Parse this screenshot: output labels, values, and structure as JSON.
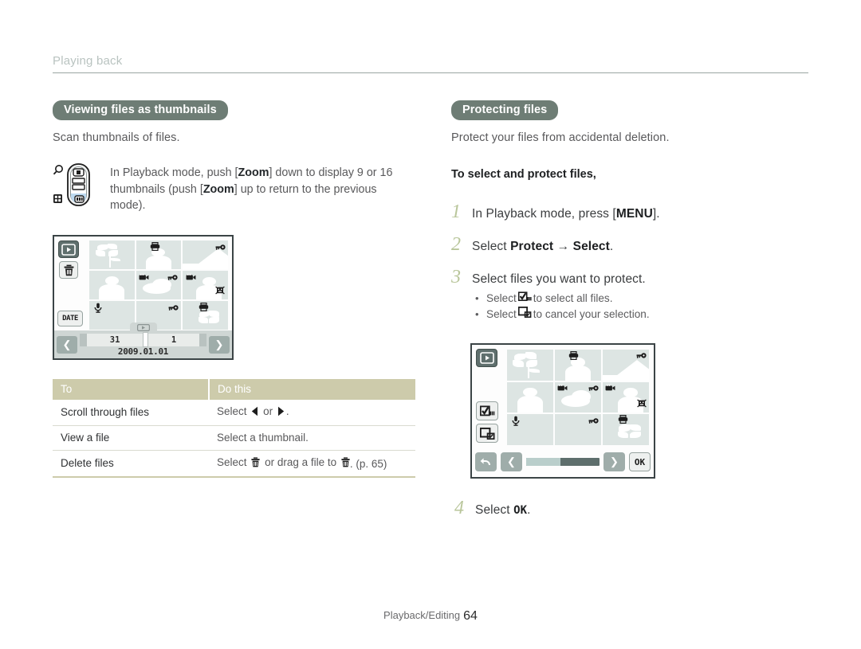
{
  "running_header": "Playing back",
  "left": {
    "section_title": "Viewing files as thumbnails",
    "lead": "Scan thumbnails of files.",
    "note": {
      "text_before_1": "In Playback mode, push [",
      "zoom_1": "Zoom",
      "text_mid_1": "] down to display 9 or 16",
      "text_before_2": "thumbnails (push [",
      "zoom_2": "Zoom",
      "text_mid_2": "] up to return to the previous mode)."
    },
    "lcd": {
      "date_left": "31",
      "date_right": "1",
      "date_label": "2009.01.01",
      "date_button": "DATE"
    },
    "table": {
      "headers": [
        "To",
        "Do this"
      ],
      "rows": [
        {
          "to": "Scroll through files",
          "do_pre": "Select",
          "do_mid": "or",
          "do_post": "."
        },
        {
          "to": "View a file",
          "do_pre": "Select a thumbnail.",
          "do_mid": "",
          "do_post": ""
        },
        {
          "to": "Delete files",
          "do_pre": "Select",
          "do_mid": "or drag a file to",
          "do_post": ". (p. 65)"
        }
      ]
    }
  },
  "right": {
    "section_title": "Protecting files",
    "lead": "Protect your files from accidental deletion.",
    "sub_head": "To select and protect files,",
    "steps": [
      {
        "num": "1",
        "pre": "In Playback mode, press [",
        "bold": "MENU",
        "post": "]."
      },
      {
        "num": "2",
        "pre": "Select ",
        "bold": "Protect",
        "arrow": " → ",
        "bold2": "Select",
        "post": "."
      },
      {
        "num": "3",
        "pre": "Select files you want to protect.",
        "bold": "",
        "post": ""
      },
      {
        "num": "4",
        "pre": "Select ",
        "bold": "OK",
        "post": "."
      }
    ],
    "bullets": [
      {
        "pre": "Select",
        "post": "to select all files."
      },
      {
        "pre": "Select",
        "post": "to cancel your selection."
      }
    ]
  },
  "footer": {
    "label": "Playback/Editing",
    "page": "64"
  },
  "colors": {
    "pill_bg": "#6e7d75",
    "table_header_bg": "#cdcbab",
    "step_number": "#b9c69b",
    "lcd_border": "#3b4446",
    "thumb_bg": "#dde5e3",
    "nav_button": "#9fadaa"
  },
  "icons": {
    "zoom_lever": "zoom-lever-icon",
    "magnifier": "magnifier-icon",
    "thumbnail_grid": "thumbnail-grid-icon",
    "play": "play-icon",
    "trash": "trash-icon",
    "date": "date-icon",
    "select_all": "select-all-icon",
    "cancel_selection": "cancel-selection-icon",
    "back": "back-icon",
    "arrow_left": "arrow-left-icon",
    "arrow_right": "arrow-right-icon",
    "ok": "ok-icon",
    "print": "print-icon",
    "protect_key": "protect-key-icon",
    "video": "video-icon",
    "voice_memo": "voice-memo-icon",
    "face": "face-icon"
  }
}
